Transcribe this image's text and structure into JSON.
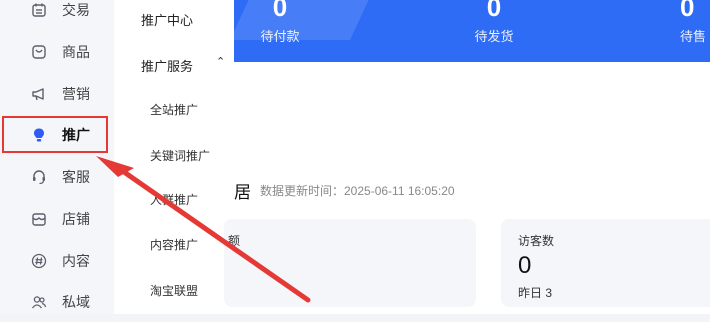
{
  "rail": [
    {
      "label": "交易",
      "icon": "calendar-icon"
    },
    {
      "label": "商品",
      "icon": "bag-icon"
    },
    {
      "label": "营销",
      "icon": "megaphone-icon"
    },
    {
      "label": "推广",
      "icon": "bulb-icon",
      "active": true
    },
    {
      "label": "客服",
      "icon": "headset-icon"
    },
    {
      "label": "店铺",
      "icon": "shop-icon"
    },
    {
      "label": "内容",
      "icon": "hash-icon"
    },
    {
      "label": "私域",
      "icon": "people-icon"
    }
  ],
  "submenu": {
    "center": "推广中心",
    "service_group": "推广服务",
    "children": [
      "全站推广",
      "关键词推广",
      "人群推广",
      "内容推广",
      "淘宝联盟"
    ]
  },
  "banner": {
    "stats": [
      {
        "value": "0",
        "caption": "待付款"
      },
      {
        "value": "0",
        "caption": "待发货"
      },
      {
        "value": "0",
        "caption": "待售"
      }
    ]
  },
  "section": {
    "title": "居",
    "updated": "数据更新时间：2025-06-11 16:05:20"
  },
  "cards": [
    {
      "title": "额"
    },
    {
      "title": "访客数",
      "value": "0",
      "sub": "昨日 3"
    }
  ],
  "colors": {
    "accent": "#2e6cf6",
    "annotation": "#e53935"
  }
}
